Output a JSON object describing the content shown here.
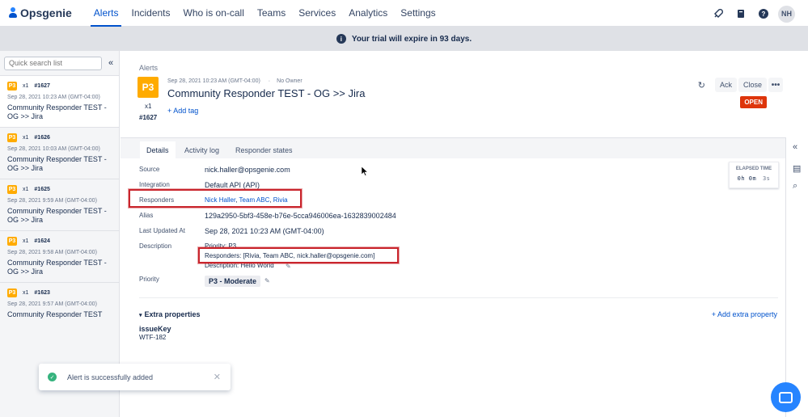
{
  "nav": {
    "brand": "Opsgenie",
    "items": [
      "Alerts",
      "Incidents",
      "Who is on-call",
      "Teams",
      "Services",
      "Analytics",
      "Settings"
    ],
    "avatar": "NH"
  },
  "banner": {
    "text": "Your trial will expire in 93 days."
  },
  "sidebar": {
    "search_placeholder": "Quick search list",
    "alerts": [
      {
        "priority": "P3",
        "count": "x1",
        "id": "#1627",
        "date": "Sep 28, 2021 10:23 AM (GMT-04:00)",
        "title": "Community Responder TEST - OG >> Jira"
      },
      {
        "priority": "P3",
        "count": "x1",
        "id": "#1626",
        "date": "Sep 28, 2021 10:03 AM (GMT-04:00)",
        "title": "Community Responder TEST - OG >> Jira"
      },
      {
        "priority": "P3",
        "count": "x1",
        "id": "#1625",
        "date": "Sep 28, 2021 9:59 AM (GMT-04:00)",
        "title": "Community Responder TEST - OG >> Jira"
      },
      {
        "priority": "P3",
        "count": "x1",
        "id": "#1624",
        "date": "Sep 28, 2021 9:58 AM (GMT-04:00)",
        "title": "Community Responder TEST - OG >> Jira"
      },
      {
        "priority": "P3",
        "count": "x1",
        "id": "#1623",
        "date": "Sep 28, 2021 9:57 AM (GMT-04:00)",
        "title": "Community Responder TEST"
      }
    ]
  },
  "alert": {
    "breadcrumb": "Alerts",
    "priority": "P3",
    "count": "x1",
    "id": "#1627",
    "date": "Sep 28, 2021 10:23 AM (GMT-04:00)",
    "owner": "No Owner",
    "title": "Community Responder TEST - OG >> Jira",
    "add_tag": "+ Add tag",
    "ack_label": "Ack",
    "close_label": "Close",
    "status": "OPEN"
  },
  "tabs": [
    "Details",
    "Activity log",
    "Responder states"
  ],
  "details": {
    "source_label": "Source",
    "source": "nick.haller@opsgenie.com",
    "integration_label": "Integration",
    "integration": "Default API (API)",
    "responders_label": "Responders",
    "responders": [
      "Nick Haller",
      "Team ABC",
      "Rivia"
    ],
    "alias_label": "Alias",
    "alias": "129a2950-5bf3-458e-b76e-5cca946006ea-1632839002484",
    "updated_label": "Last Updated At",
    "updated": "Sep 28, 2021 10:23 AM (GMT-04:00)",
    "description_label": "Description",
    "description_lines": [
      "Priority: P3",
      "Responders: [Rivia, Team ABC, nick.haller@opsgenie.com]",
      "Description: Hello World"
    ],
    "priority_label": "Priority",
    "priority": "P3 - Moderate"
  },
  "elapsed": {
    "label": "ELAPSED TIME",
    "h": "0h",
    "m": "0m",
    "s": "3s"
  },
  "extra": {
    "header": "Extra properties",
    "add_label": "+ Add extra property",
    "key": "issueKey",
    "value": "WTF-182"
  },
  "toast": {
    "text": "Alert is successfully added"
  }
}
